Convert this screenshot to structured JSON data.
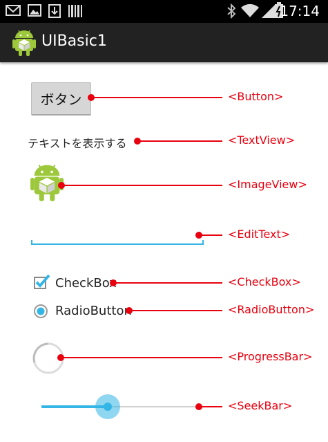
{
  "status_bar": {
    "time": "17:14"
  },
  "action_bar": {
    "title": "UIBasic1"
  },
  "widgets": {
    "button_label": "ボタン",
    "textview_text": "テキストを表示する",
    "checkbox_label": "CheckBox",
    "checkbox_checked": true,
    "radio_label": "RadioButton",
    "radio_selected": true,
    "seekbar_value_fraction": 0.42
  },
  "annotations": {
    "button": "<Button>",
    "textview": "<TextView>",
    "imageview": "<ImageView>",
    "edittext": "<EditText>",
    "checkbox": "<CheckBox>",
    "radiobutton": "<RadioButton>",
    "progressbar": "<ProgressBar>",
    "seekbar": "<SeekBar>"
  },
  "colors": {
    "accent": "#33b5e5",
    "annotation": "#e8000e",
    "action_bar": "#222222",
    "status_bar": "#000000"
  },
  "icons": [
    "gmail-icon",
    "gallery-icon",
    "download-icon",
    "barcode-icon",
    "bluetooth-icon",
    "wifi-icon",
    "signal-icon",
    "battery-icon",
    "android-app-icon"
  ]
}
